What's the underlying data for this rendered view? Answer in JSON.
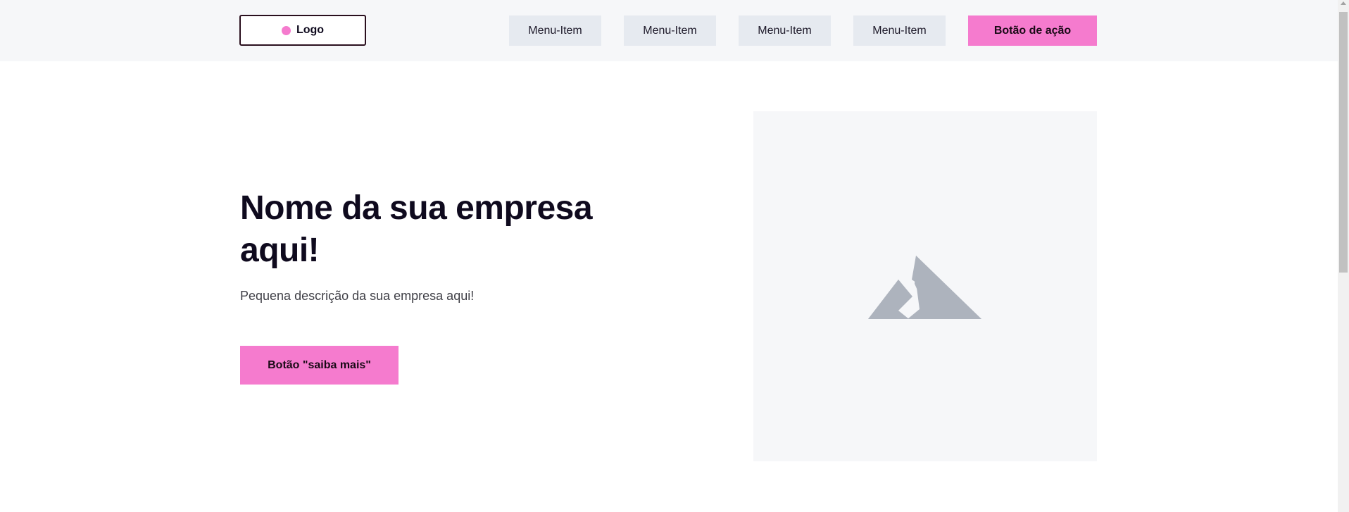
{
  "header": {
    "logo_label": "Logo",
    "menu_items": [
      "Menu-Item",
      "Menu-Item",
      "Menu-Item",
      "Menu-Item"
    ],
    "action_button_label": "Botão de ação"
  },
  "hero": {
    "title": "Nome da sua empresa aqui!",
    "description": "Pequena descrição da sua empresa aqui!",
    "more_button_label": "Botão \"saiba mais\""
  },
  "icons": {
    "logo_dot": "dot-icon",
    "image_placeholder": "image-mountain-icon"
  },
  "colors": {
    "accent": "#f57bce",
    "header_bg": "#f6f7f9",
    "menu_item_bg": "#e6eaf0",
    "placeholder_bg": "#f6f7f9",
    "placeholder_icon": "#adb3bd",
    "text_dark": "#0f0a1e"
  }
}
